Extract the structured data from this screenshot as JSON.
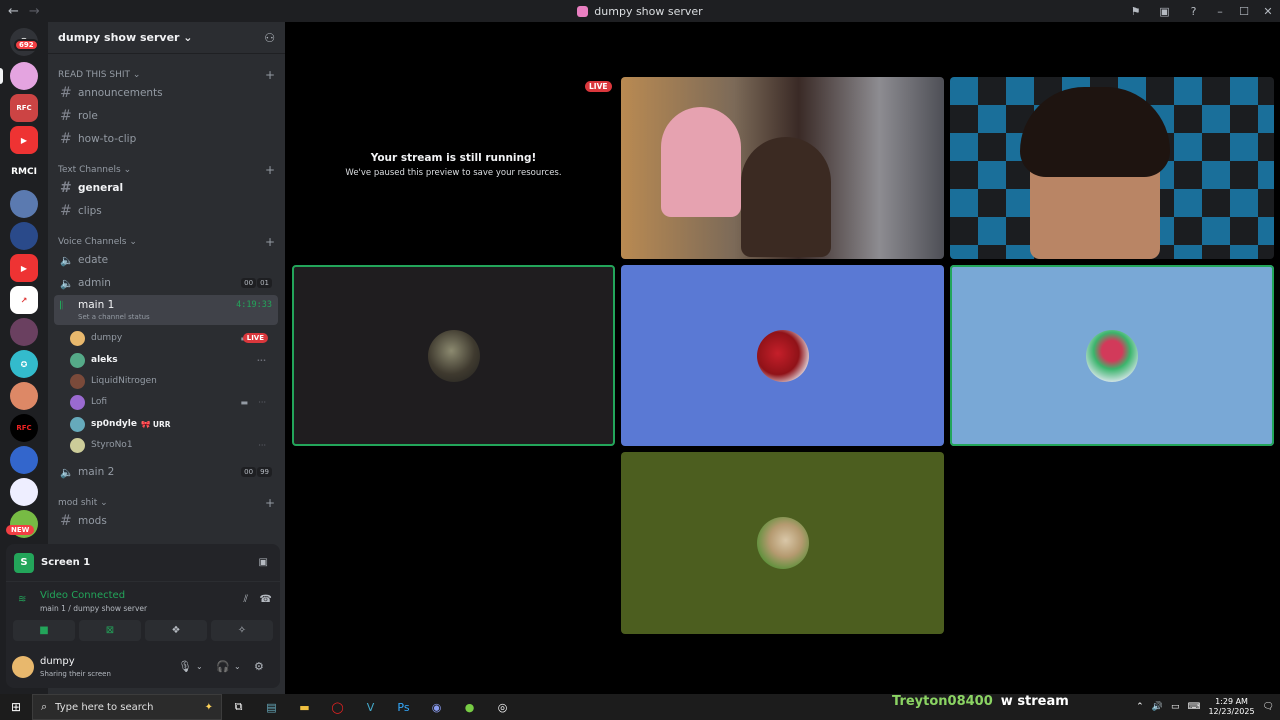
{
  "titlebar": {
    "title": "dumpy show server",
    "back": "←",
    "forward": "→",
    "icons": [
      "inbox-icon",
      "window-icon",
      "help-icon"
    ]
  },
  "rail": {
    "badge": "692",
    "rmci": "RMCI",
    "new_badge": "NEW"
  },
  "server": {
    "name": "dumpy show server"
  },
  "categories": [
    {
      "label": "READ THIS SHIT"
    },
    {
      "label": "Text Channels"
    },
    {
      "label": "Voice Channels"
    },
    {
      "label": "mod shit"
    }
  ],
  "channels": {
    "announcements": "announcements",
    "role": "role",
    "how_to_clip": "how-to-clip",
    "general": "general",
    "clips": "clips",
    "edate": "edate",
    "admin": "admin",
    "admin_count": [
      "00",
      "01"
    ],
    "main1": "main 1",
    "main1_time": "4:19:33",
    "main1_status": "Set a channel status",
    "main2": "main 2",
    "main2_count": [
      "00",
      "99"
    ],
    "mods": "mods"
  },
  "voice_users": [
    {
      "name": "dumpy",
      "live": "LIVE"
    },
    {
      "name": "aleks"
    },
    {
      "name": "LiquidNitrogen"
    },
    {
      "name": "Lofi"
    },
    {
      "name": "sp0ndyle",
      "tag": "URR"
    },
    {
      "name": "StyroNo1"
    }
  ],
  "panel": {
    "screen_title": "Screen 1",
    "connected": "Video Connected",
    "location": "main 1 / dumpy show server"
  },
  "user": {
    "name": "dumpy",
    "status": "Sharing their screen"
  },
  "stage": {
    "live": "LIVE",
    "paused_title": "Your stream is still running!",
    "paused_sub": "We've paused this preview to save your resources."
  },
  "taskbar": {
    "search_placeholder": "Type here to search",
    "time": "1:29 AM",
    "date": "12/23/2025"
  },
  "overlay": {
    "user": "Treyton08400",
    "message": "w stream"
  },
  "colors": {
    "accent_green": "#23a55a",
    "live_red": "#da373c",
    "tile_blue": "#5a79d4",
    "tile_lightblue": "#79a8d6",
    "tile_olive": "#4c5e1f"
  }
}
